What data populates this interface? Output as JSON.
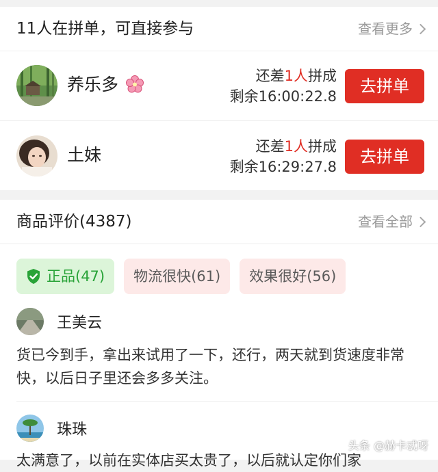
{
  "group": {
    "title": "11人在拼单，可直接参与",
    "more_label": "查看更多",
    "rows": [
      {
        "name": "养乐多",
        "status_prefix": "还差",
        "status_num": "1人",
        "status_suffix": "拼成",
        "remaining": "剩余16:00:22.8",
        "button": "去拼单"
      },
      {
        "name": "土妹",
        "status_prefix": "还差",
        "status_num": "1人",
        "status_suffix": "拼成",
        "remaining": "剩余16:29:27.8",
        "button": "去拼单"
      }
    ]
  },
  "reviews": {
    "title": "商品评价(4387)",
    "more_label": "查看全部",
    "tags": [
      {
        "label": "正品(47)"
      },
      {
        "label": "物流很快(61)"
      },
      {
        "label": "效果很好(56)"
      }
    ],
    "items": [
      {
        "name": "王美云",
        "text": "货已今到手，拿出来试用了一下，还行，两天就到货速度非常快，以后日子里还会多多关注。"
      },
      {
        "name": "珠珠",
        "text": "太满意了，以前在实体店买太贵了，以后就认定你们家"
      }
    ]
  },
  "watermark": "头条 @赫卡忒呀",
  "colors": {
    "accent_red": "#e02e24",
    "tag_green_bg": "#dcf5d9",
    "tag_green_text": "#29a338",
    "tag_pink_bg": "#fde9e8"
  },
  "icons": {
    "chevron": "chevron-right-icon",
    "shield": "shield-check-icon",
    "flower": "cherry-blossom-icon"
  }
}
